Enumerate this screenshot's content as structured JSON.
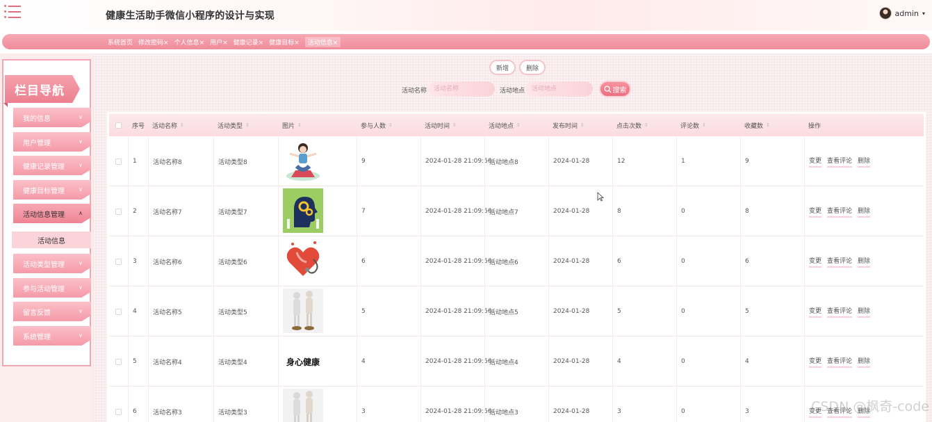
{
  "header": {
    "title": "健康生活助手微信小程序的设计与实现",
    "username": "admin",
    "caret": "▾"
  },
  "tabs": [
    "系统首页",
    "修改密码×",
    "个人信息×",
    "用户×",
    "健康记录×",
    "健康目标×",
    "活动信息×"
  ],
  "sidebar": {
    "title": "栏目导航",
    "items": [
      {
        "label": "我的信息"
      },
      {
        "label": "用户管理"
      },
      {
        "label": "健康记录管理"
      },
      {
        "label": "健康目标管理"
      },
      {
        "label": "活动信息管理"
      },
      {
        "label": "活动类型管理"
      },
      {
        "label": "参与活动管理"
      },
      {
        "label": "留言反馈"
      },
      {
        "label": "系统管理"
      }
    ],
    "active_sub": "活动信息"
  },
  "toolbar": {
    "add_label": "新增",
    "delete_label": "删除",
    "name_label": "活动名称",
    "name_placeholder": "活动名称",
    "place_label": "活动地点",
    "place_placeholder": "活动地点",
    "search_label": "搜索"
  },
  "table": {
    "headers": [
      "序号",
      "活动名称",
      "活动类型",
      "图片",
      "参与人数",
      "活动时间",
      "活动地点",
      "发布时间",
      "点击次数",
      "评论数",
      "收藏数",
      "操作"
    ],
    "actions": [
      "变更",
      "查看评论",
      "删除"
    ],
    "rows": [
      {
        "no": "1",
        "name": "活动名称8",
        "type": "活动类型8",
        "image": "yoga-illustration",
        "count": "9",
        "time": "2024-01-28 21:09:56",
        "place": "活动地点8",
        "publish": "2024-01-28",
        "clicks": "12",
        "comments": "1",
        "favs": "9"
      },
      {
        "no": "2",
        "name": "活动名称7",
        "type": "活动类型7",
        "image": "brain-gears-illustration",
        "count": "7",
        "time": "2024-01-28 21:09:56",
        "place": "活动地点7",
        "publish": "2024-01-28",
        "clicks": "8",
        "comments": "0",
        "favs": "8"
      },
      {
        "no": "3",
        "name": "活动名称6",
        "type": "活动类型6",
        "image": "heart-stethoscope-illustration",
        "count": "6",
        "time": "2024-01-28 21:09:56",
        "place": "活动地点6",
        "publish": "2024-01-28",
        "clicks": "6",
        "comments": "0",
        "favs": "6"
      },
      {
        "no": "4",
        "name": "活动名称5",
        "type": "活动类型5",
        "image": "anatomy-figures-photo",
        "count": "5",
        "time": "2024-01-28 21:09:56",
        "place": "活动地点5",
        "publish": "2024-01-28",
        "clicks": "5",
        "comments": "0",
        "favs": "5"
      },
      {
        "no": "5",
        "name": "活动名称4",
        "type": "活动类型4",
        "image": "calligraphy-text",
        "image_text": "身心健康",
        "count": "4",
        "time": "2024-01-28 21:09:56",
        "place": "活动地点4",
        "publish": "2024-01-28",
        "clicks": "4",
        "comments": "0",
        "favs": "4"
      },
      {
        "no": "6",
        "name": "活动名称3",
        "type": "活动类型3",
        "image": "anatomy-figures-photo",
        "count": "3",
        "time": "2024-01-28 21:09:56",
        "place": "活动地点3",
        "publish": "2024-01-28",
        "clicks": "3",
        "comments": "0",
        "favs": "3"
      }
    ]
  },
  "watermark": "CSDN @枫奇-code"
}
